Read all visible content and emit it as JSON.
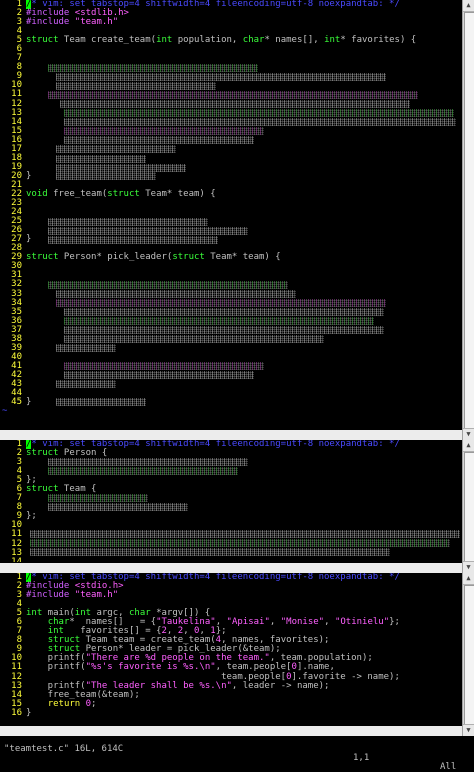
{
  "editor": {
    "name": "vim",
    "colors": {
      "background": "#000000",
      "line_number": "#ffff3a",
      "comment": "#4a4aff",
      "type": "#3aff3a",
      "string": "#ff60ff",
      "preproc": "#d060ff",
      "status_bg": "#ececec"
    }
  },
  "pane1": {
    "lines": [
      {
        "n": "1",
        "modeline": "/* vim: set tabstop=4 shiftwidth=4 fileencoding=utf-8 noexpandtab: */"
      },
      {
        "n": "2",
        "pp": "#include",
        "st": "<stdlib.h>"
      },
      {
        "n": "3",
        "pp": "#include",
        "st": "\"team.h\""
      },
      {
        "n": "4"
      },
      {
        "n": "5",
        "a": "struct",
        "b": " Team create_team(",
        "c": "int",
        "d": " population, ",
        "e": "char",
        "f": "* names[], ",
        "g": "int",
        "h": "* favorites) {"
      },
      {
        "n": "6"
      },
      {
        "n": "7"
      },
      {
        "n": "8"
      },
      {
        "n": "9"
      },
      {
        "n": "10"
      },
      {
        "n": "11"
      },
      {
        "n": "12"
      },
      {
        "n": "13"
      },
      {
        "n": "14"
      },
      {
        "n": "15"
      },
      {
        "n": "16"
      },
      {
        "n": "17"
      },
      {
        "n": "18"
      },
      {
        "n": "19"
      },
      {
        "n": "20",
        "t": "}"
      },
      {
        "n": "21"
      },
      {
        "n": "22",
        "a": "void",
        "b": " free_team(",
        "c": "struct",
        "d": " Team* team) {"
      },
      {
        "n": "23"
      },
      {
        "n": "24"
      },
      {
        "n": "25"
      },
      {
        "n": "26"
      },
      {
        "n": "27",
        "t": "}"
      },
      {
        "n": "28"
      },
      {
        "n": "29",
        "a": "struct",
        "b": " Person* pick_leader(",
        "c": "struct",
        "d": " Team* team) {"
      },
      {
        "n": "30"
      },
      {
        "n": "31"
      },
      {
        "n": "32"
      },
      {
        "n": "33"
      },
      {
        "n": "34"
      },
      {
        "n": "35"
      },
      {
        "n": "36"
      },
      {
        "n": "37"
      },
      {
        "n": "38"
      },
      {
        "n": "39"
      },
      {
        "n": "40"
      },
      {
        "n": "41"
      },
      {
        "n": "42"
      },
      {
        "n": "43"
      },
      {
        "n": "44"
      },
      {
        "n": "45",
        "t": "}"
      }
    ],
    "tilde": "~",
    "status": {
      "filename": "team.c",
      "position": "1,1",
      "scroll": "All"
    }
  },
  "pane2": {
    "lines": [
      {
        "n": "1",
        "modeline": "/* vim: set tabstop=4 shiftwidth=4 fileencoding=utf-8 noexpandtab: */"
      },
      {
        "n": "2",
        "a": "struct",
        "b": " Person {"
      },
      {
        "n": "3"
      },
      {
        "n": "4"
      },
      {
        "n": "5",
        "t": "};"
      },
      {
        "n": "6",
        "a": "struct",
        "b": " Team {"
      },
      {
        "n": "7"
      },
      {
        "n": "8"
      },
      {
        "n": "9",
        "t": "};"
      },
      {
        "n": "10"
      },
      {
        "n": "11"
      },
      {
        "n": "12"
      },
      {
        "n": "13"
      },
      {
        "n": "14"
      }
    ],
    "status": {
      "filename": "team.h",
      "position": "1,1",
      "scroll": "All"
    }
  },
  "pane3": {
    "lines": [
      {
        "n": "1",
        "modeline": "/* vim: set tabstop=4 shiftwidth=4 fileencoding=utf-8 noexpandtab: */"
      },
      {
        "n": "2",
        "pp": "#include",
        "st": "<stdio.h>"
      },
      {
        "n": "3",
        "pp": "#include",
        "st": "\"team.h\""
      },
      {
        "n": "4"
      },
      {
        "n": "5",
        "code": "int main(int argc, char *argv[]) {"
      },
      {
        "n": "6",
        "code": "    char*  names[]   = {\"Taukelina\", \"Apisai\", \"Monise\", \"Otinielu\"};"
      },
      {
        "n": "7",
        "code": "    int   favorites[] = {2, 2, 0, 1};"
      },
      {
        "n": "8",
        "code": "    struct Team team = create_team(4, names, favorites);"
      },
      {
        "n": "9",
        "code": "    struct Person* leader = pick_leader(&team);"
      },
      {
        "n": "10",
        "code": "    printf(\"There are %d people on the team.\", team.population);"
      },
      {
        "n": "11",
        "code": "    printf(\"%s's favorite is %s.\\n\", team.people[0].name,"
      },
      {
        "n": "12",
        "code": "                                    team.people[0].favorite -> name);"
      },
      {
        "n": "13",
        "code": "    printf(\"The leader shall be %s.\\n\", leader -> name);"
      },
      {
        "n": "14",
        "code": "    free_team(&team);"
      },
      {
        "n": "15",
        "code": "    return 0;"
      },
      {
        "n": "16",
        "code": "}"
      }
    ],
    "status": {
      "filename": "teamtest.c",
      "position": "1,1",
      "scroll": "All"
    }
  },
  "command_line": {
    "text": "\"teamtest.c\" 16L, 614C",
    "position": "1,1",
    "scroll": "All"
  }
}
